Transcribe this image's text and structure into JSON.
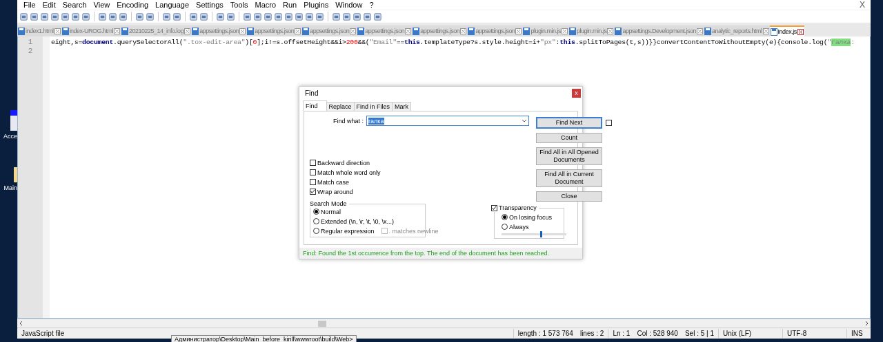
{
  "menu": [
    "File",
    "Edit",
    "Search",
    "View",
    "Encoding",
    "Language",
    "Settings",
    "Tools",
    "Macro",
    "Run",
    "Plugins",
    "Window",
    "?"
  ],
  "window_close": "X",
  "tabs": [
    {
      "label": "index1.html",
      "selected": false
    },
    {
      "label": "index-UROG.html",
      "selected": false
    },
    {
      "label": "20210225_14_info.log",
      "selected": false
    },
    {
      "label": "appsettings.json",
      "selected": false
    },
    {
      "label": "appsettings.json",
      "selected": false
    },
    {
      "label": "appsettings.json",
      "selected": false
    },
    {
      "label": "appsettings.json",
      "selected": false
    },
    {
      "label": "appsettings.json",
      "selected": false
    },
    {
      "label": "appsettings.json",
      "selected": false
    },
    {
      "label": "plugin.min.js",
      "selected": false
    },
    {
      "label": "plugin.min.js",
      "selected": false
    },
    {
      "label": "appsettings.Development.json",
      "selected": false
    },
    {
      "label": "analytic_reports.html",
      "selected": false
    },
    {
      "label": "Index.js",
      "selected": true
    }
  ],
  "editor": {
    "line_numbers": [
      "1",
      "2"
    ],
    "line_1": [
      {
        "kind": "plain",
        "text": "eight,s="
      },
      {
        "kind": "keyword",
        "text": "document"
      },
      {
        "kind": "plain",
        "text": ".querySelectorAll("
      },
      {
        "kind": "string",
        "text": "\".tox-edit-area\""
      },
      {
        "kind": "plain",
        "text": ")["
      },
      {
        "kind": "number",
        "text": "0"
      },
      {
        "kind": "plain",
        "text": "];i!=s.offsetHeight&&i>"
      },
      {
        "kind": "number",
        "text": "200"
      },
      {
        "kind": "plain",
        "text": "&&("
      },
      {
        "kind": "string",
        "text": "\"Email\""
      },
      {
        "kind": "plain",
        "text": "=="
      },
      {
        "kind": "keyword",
        "text": "this"
      },
      {
        "kind": "plain",
        "text": ".templateType?s.style.height=i+"
      },
      {
        "kind": "string",
        "text": "\"px\""
      },
      {
        "kind": "plain",
        "text": ":"
      },
      {
        "kind": "keyword",
        "text": "this"
      },
      {
        "kind": "plain",
        "text": ".splitToPages(t,s))}}convertContentToWithoutEmpty(e){console.log("
      },
      {
        "kind": "string",
        "text": "\""
      },
      {
        "kind": "match",
        "text": "галка"
      },
      {
        "kind": "string",
        "text": ":"
      }
    ]
  },
  "find_dialog": {
    "title": "Find",
    "close": "x",
    "tabs": [
      {
        "label": "Find",
        "selected": true
      },
      {
        "label": "Replace",
        "selected": false
      },
      {
        "label": "Find in Files",
        "selected": false
      },
      {
        "label": "Mark",
        "selected": false
      }
    ],
    "find_what_label": "Find what :",
    "find_what_value": "галка",
    "buttons": [
      "Find Next",
      "Count",
      "Find All in All Opened Documents",
      "Find All in Current Document",
      "Close"
    ],
    "side_checkbox_checked": false,
    "options": [
      {
        "label": "Backward direction",
        "checked": false
      },
      {
        "label": "Match whole word only",
        "checked": false
      },
      {
        "label": "Match case",
        "checked": false
      },
      {
        "label": "Wrap around",
        "checked": true
      }
    ],
    "search_mode": {
      "title": "Search Mode",
      "modes": [
        {
          "label": "Normal",
          "selected": true
        },
        {
          "label": "Extended (\\n, \\r, \\t, \\0, \\x...)",
          "selected": false
        },
        {
          "label": "Regular expression",
          "selected": false
        }
      ],
      "matches_newline": {
        "label": ". matches newline",
        "checked": false
      }
    },
    "transparency": {
      "label": "Transparency",
      "checked": true,
      "modes": [
        {
          "label": "On losing focus",
          "selected": true
        },
        {
          "label": "Always",
          "selected": false
        }
      ],
      "level": 0.62
    },
    "status": "Find: Found the 1st occurrence from the top. The end of the document has been reached."
  },
  "status_bar": {
    "file_type": "JavaScript file",
    "length": "length : 1 573 764",
    "lines": "lines : 2",
    "ln": "Ln : 1",
    "col": "Col : 528 940",
    "sel": "Sel : 5 | 1",
    "eol": "Unix (LF)",
    "encoding": "UTF-8",
    "mode": "INS"
  },
  "desktop_icons": [
    {
      "label": "Acce"
    },
    {
      "label": "Main"
    }
  ],
  "taskbar_tooltip": "Администратор\\Desktop\\Main_before_kirill\\wwwroot\\build\\Web>"
}
